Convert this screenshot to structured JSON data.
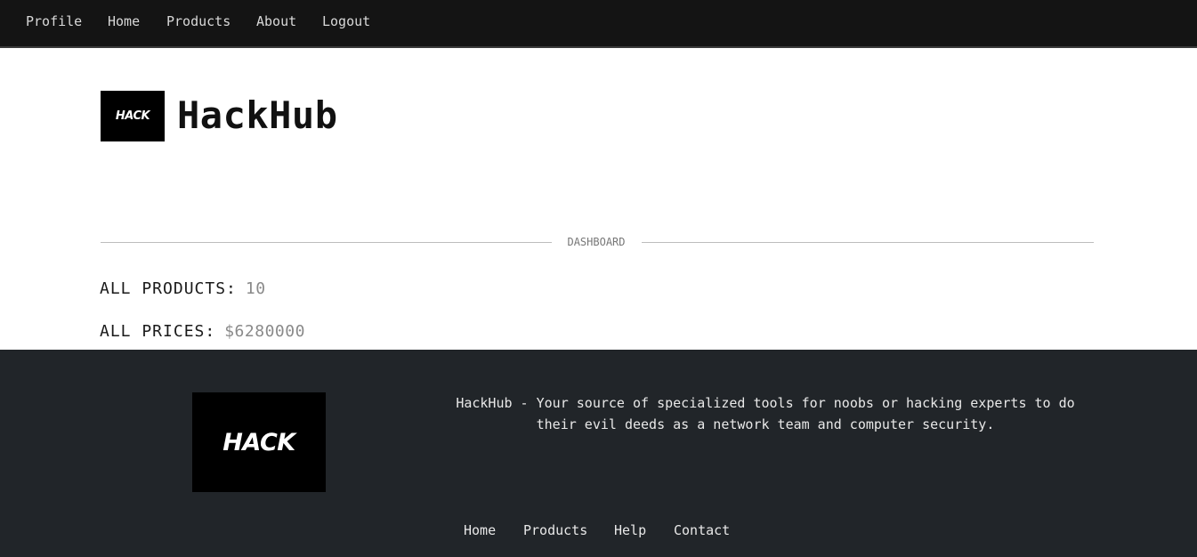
{
  "topnav": {
    "items": [
      {
        "label": "Profile"
      },
      {
        "label": "Home"
      },
      {
        "label": "Products"
      },
      {
        "label": "About"
      },
      {
        "label": "Logout"
      }
    ]
  },
  "brand": {
    "logo_text": "HACK",
    "title": "HackHub"
  },
  "section": {
    "label": "DASHBOARD"
  },
  "stats": {
    "products_label": "ALL PRODUCTS:",
    "products_value": "10",
    "prices_label": "ALL PRICES:",
    "prices_value": "$6280000"
  },
  "footer": {
    "logo_text": "HACK",
    "description": "HackHub - Your source of specialized tools for noobs or hacking experts to do their evil deeds as a network team and computer security.",
    "nav": [
      {
        "label": "Home"
      },
      {
        "label": "Products"
      },
      {
        "label": "Help"
      },
      {
        "label": "Contact"
      }
    ]
  },
  "colors": {
    "topnav_bg": "#141414",
    "footer_bg": "#212529",
    "logo_bg": "#000000"
  }
}
